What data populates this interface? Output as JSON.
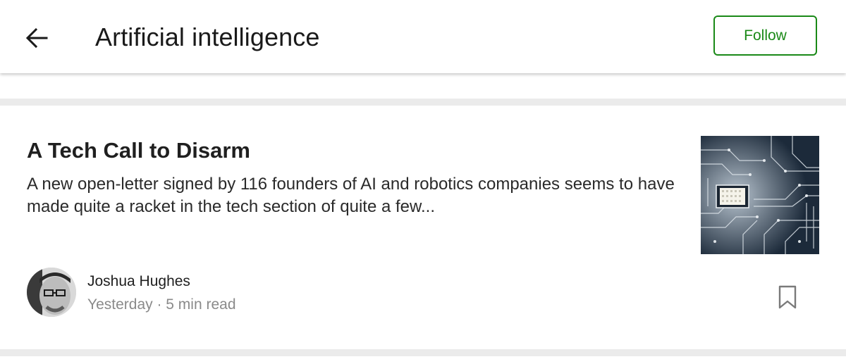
{
  "header": {
    "back_icon": "arrow-left-icon",
    "title": "Artificial intelligence",
    "follow_label": "Follow",
    "accent_color": "#1a8917"
  },
  "article": {
    "title": "A Tech Call to Disarm",
    "excerpt": "A new open-letter signed by 116 founders of AI and robotics companies seems to have made quite a racket in the tech section of quite a few...",
    "thumbnail_icon": "circuit-board-image",
    "author": {
      "name": "Joshua Hughes",
      "avatar_icon": "author-avatar"
    },
    "date": "Yesterday",
    "separator": " · ",
    "read_time": "5 min read",
    "bookmark_icon": "bookmark-icon"
  }
}
